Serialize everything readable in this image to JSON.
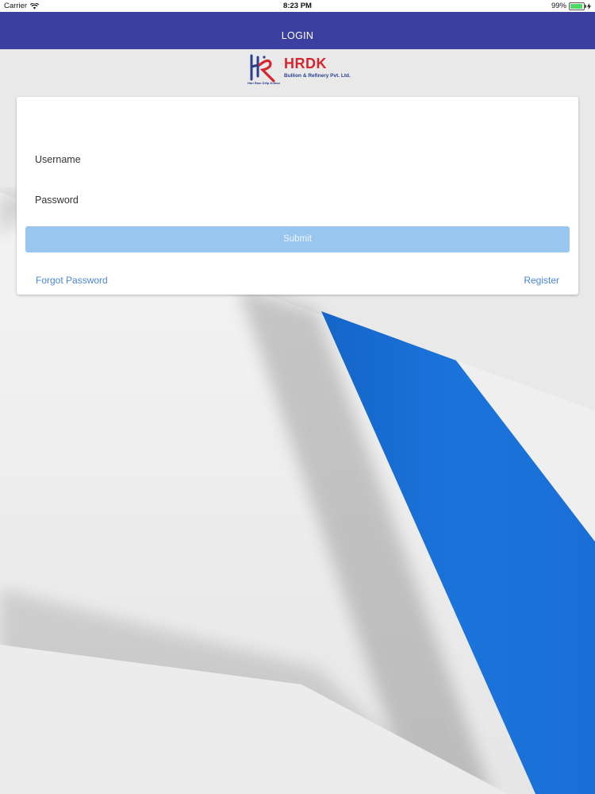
{
  "status_bar": {
    "carrier": "Carrier",
    "time": "8:23 PM",
    "battery": "99%"
  },
  "nav": {
    "title": "LOGIN"
  },
  "logo": {
    "title": "HRDK",
    "subtitle": "Bullion & Refinery Pvt. Ltd.",
    "tagline": "Hari Ram Dilip Kumar"
  },
  "form": {
    "username_label": "Username",
    "password_label": "Password",
    "submit_label": "Submit",
    "forgot_label": "Forgot Password",
    "register_label": "Register"
  },
  "colors": {
    "navbar": "#3a3fa0",
    "accent_blue": "#1a73d9",
    "submit_disabled": "#99c6ef",
    "link": "#4a86d6",
    "logo_red": "#d3262e"
  }
}
